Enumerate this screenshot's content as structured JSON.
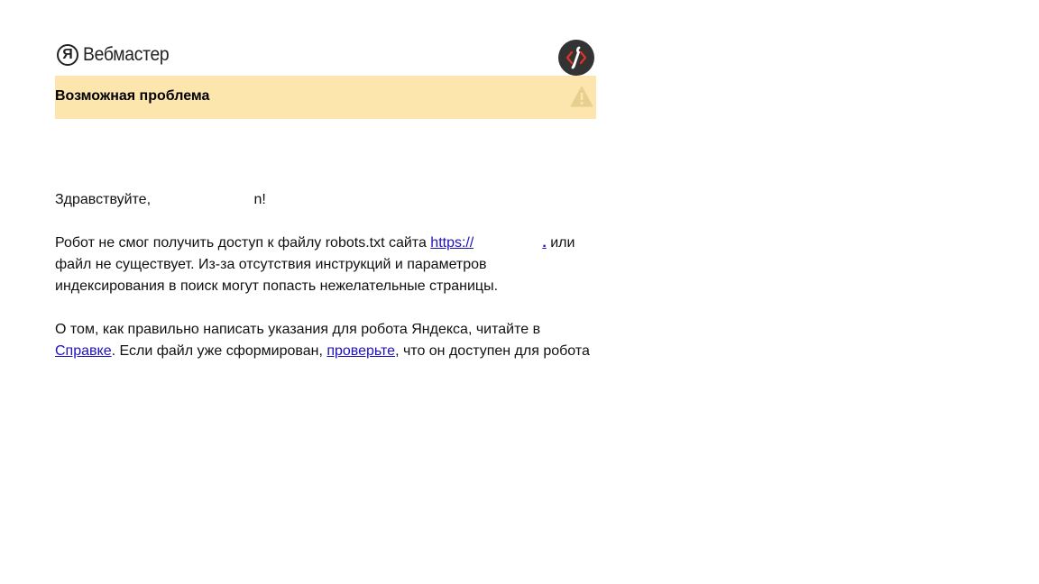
{
  "header": {
    "logo_mark": "Я",
    "logo_text": "Вебмастер"
  },
  "banner": {
    "title": "Возможная проблема"
  },
  "message": {
    "greeting_prefix": "Здравствуйте, ",
    "greeting_suffix": "n!",
    "p1_text_1": "Робот не смог получить доступ к файлу robots.txt сайта ",
    "p1_link": "https://",
    "p1_link_tail": ".",
    "p1_text_2": " или файл не существует. Из-за отсутствия инструкций и параметров индексирования в поиск могут попасть нежелательные страницы.",
    "p2_text_1": "О том, как правильно написать указания для робота Яндекса, читайте в ",
    "p2_link_help": "Справке",
    "p2_text_2": ". Если файл уже сформирован, ",
    "p2_link_check": "проверьте",
    "p2_text_3": ", что он доступен для робота"
  },
  "colors": {
    "banner_bg": "#fde5ae",
    "link": "#1f12b8",
    "tool_icon_bg": "#333333",
    "tool_icon_accent": "#e0312a"
  }
}
